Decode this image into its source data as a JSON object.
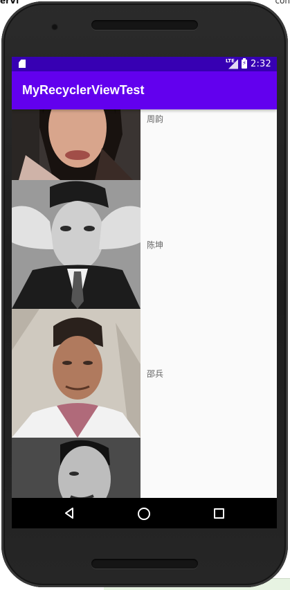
{
  "ide": {
    "left_text": "erVi",
    "right_text": "con"
  },
  "status_bar": {
    "network_label": "LTE",
    "time": "2:32",
    "background": "#3700b3"
  },
  "app_bar": {
    "title": "MyRecyclerViewTest",
    "background": "#6200ee"
  },
  "list": {
    "items": [
      {
        "name": "周韵",
        "photo_icon": "portrait-photo"
      },
      {
        "name": "陈坤",
        "photo_icon": "portrait-photo"
      },
      {
        "name": "邵兵",
        "photo_icon": "portrait-photo"
      },
      {
        "name": "",
        "photo_icon": "portrait-photo"
      }
    ]
  },
  "nav_bar": {
    "back_icon": "back-triangle-icon",
    "home_icon": "home-circle-icon",
    "recents_icon": "recents-square-icon"
  }
}
